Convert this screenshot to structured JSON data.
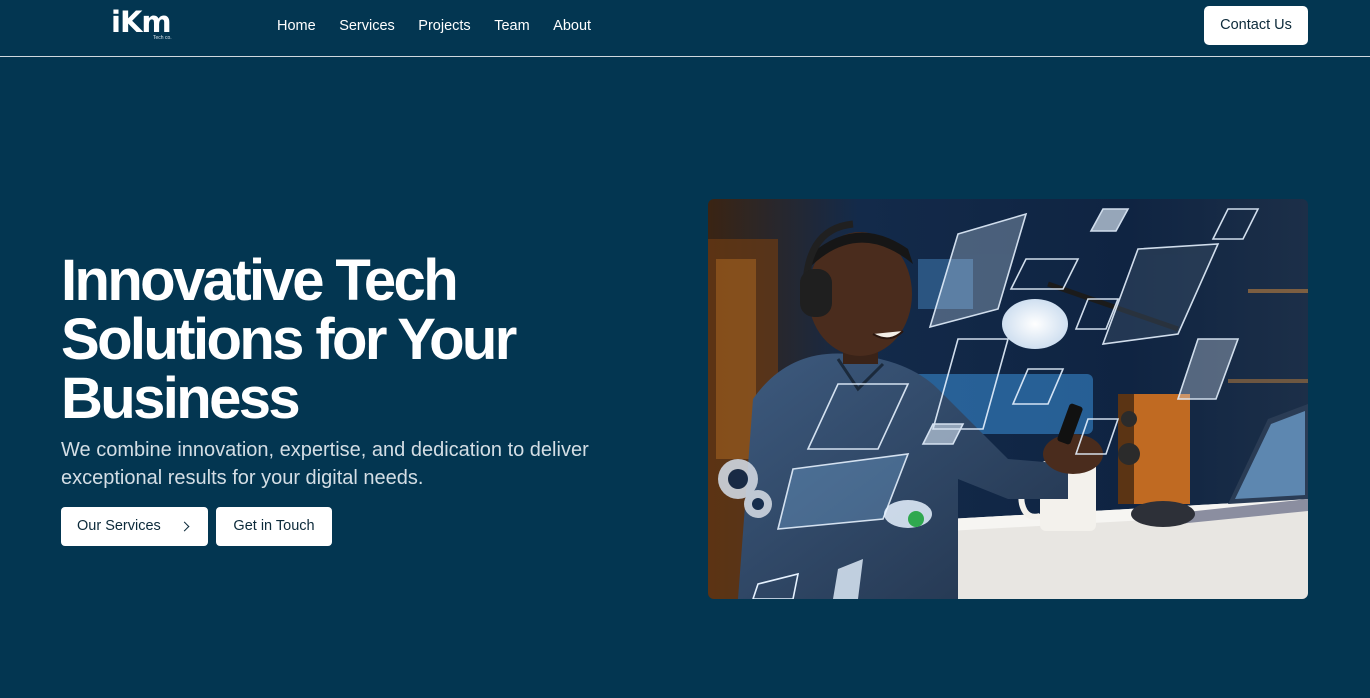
{
  "header": {
    "logo_text": "iKm",
    "logo_subtext": "Tech co.",
    "nav": [
      {
        "label": "Home"
      },
      {
        "label": "Services"
      },
      {
        "label": "Projects"
      },
      {
        "label": "Team"
      },
      {
        "label": "About"
      }
    ],
    "contact_label": "Contact Us"
  },
  "hero": {
    "title_lines": [
      "Innovative Tech",
      "Solutions for Your",
      "Business"
    ],
    "subtitle": "We combine innovation, expertise, and dedication to deliver exceptional results for your digital needs.",
    "primary_button": "Our Services",
    "secondary_button": "Get in Touch"
  },
  "colors": {
    "background": "#033651",
    "button_bg": "#ffffff",
    "button_text": "#0c2a3a"
  },
  "icons": {
    "primary_button_icon": "chevron-right-icon"
  }
}
